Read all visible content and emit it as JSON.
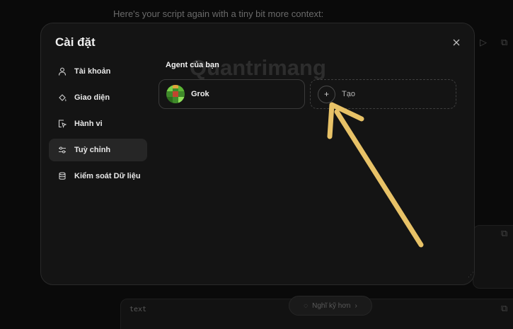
{
  "background": {
    "chat_text": "Here's your script again with a tiny bit more context:",
    "code_label": "text",
    "suggestion_label": "Nghĩ kỹ hơn"
  },
  "settings": {
    "title": "Cài đặt",
    "nav_items": [
      {
        "label": "Tài khoản",
        "icon": "user-icon"
      },
      {
        "label": "Giao diện",
        "icon": "paint-bucket-icon"
      },
      {
        "label": "Hành vi",
        "icon": "cursor-box-icon"
      },
      {
        "label": "Tuỳ chỉnh",
        "icon": "sliders-icon",
        "active": true
      },
      {
        "label": "Kiểm soát Dữ liệu",
        "icon": "database-icon"
      }
    ],
    "section_title": "Agent của bạn",
    "agents": [
      {
        "name": "Grok"
      }
    ],
    "create_label": "Tạo"
  },
  "watermark": "Quantrimang",
  "colors": {
    "arrow": "#e8c267",
    "modal_bg": "#141414",
    "active_nav": "#262626"
  }
}
